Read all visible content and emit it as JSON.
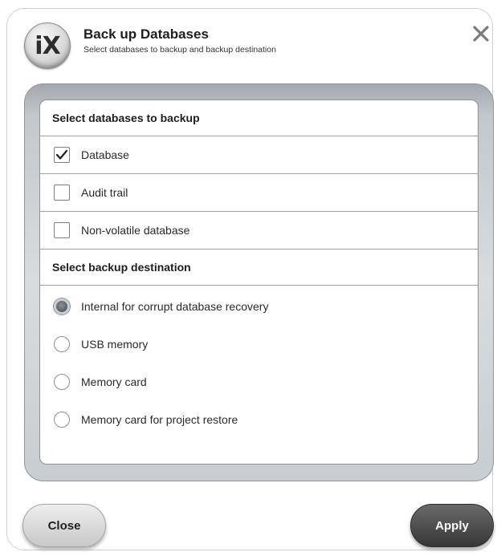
{
  "dialog": {
    "logo_text": "iX",
    "title": "Back up Databases",
    "subtitle": "Select databases to backup and backup destination"
  },
  "databases": {
    "header": "Select databases to backup",
    "items": [
      {
        "label": "Database",
        "checked": true
      },
      {
        "label": "Audit trail",
        "checked": false
      },
      {
        "label": "Non-volatile database",
        "checked": false
      }
    ]
  },
  "destination": {
    "header": "Select backup destination",
    "options": [
      {
        "label": "Internal for corrupt database recovery",
        "selected": true
      },
      {
        "label": "USB memory",
        "selected": false
      },
      {
        "label": "Memory card",
        "selected": false
      },
      {
        "label": "Memory card for project restore",
        "selected": false
      }
    ]
  },
  "buttons": {
    "close_label": "Close",
    "apply_label": "Apply"
  },
  "icons": {
    "close": "close-icon",
    "check": "checkmark-icon"
  },
  "colors": {
    "apply_button": "#474747",
    "close_button": "#d8d8d8",
    "panel_frame": "#c3c8cd"
  }
}
